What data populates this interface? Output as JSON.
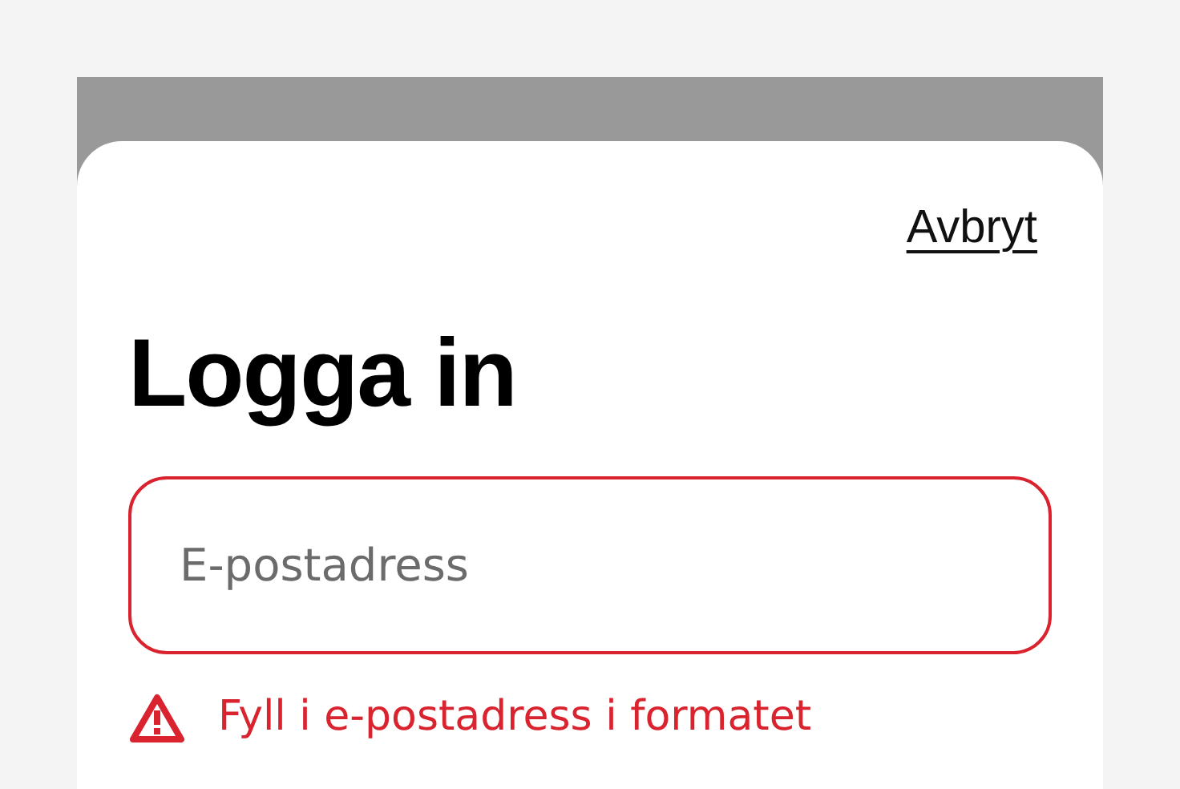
{
  "dialog": {
    "cancel_link": "Avbryt",
    "title": "Logga in"
  },
  "email_field": {
    "placeholder": "E-postadress",
    "invalid": true
  },
  "error_message": "Fyll i e-postadress i formatet"
}
